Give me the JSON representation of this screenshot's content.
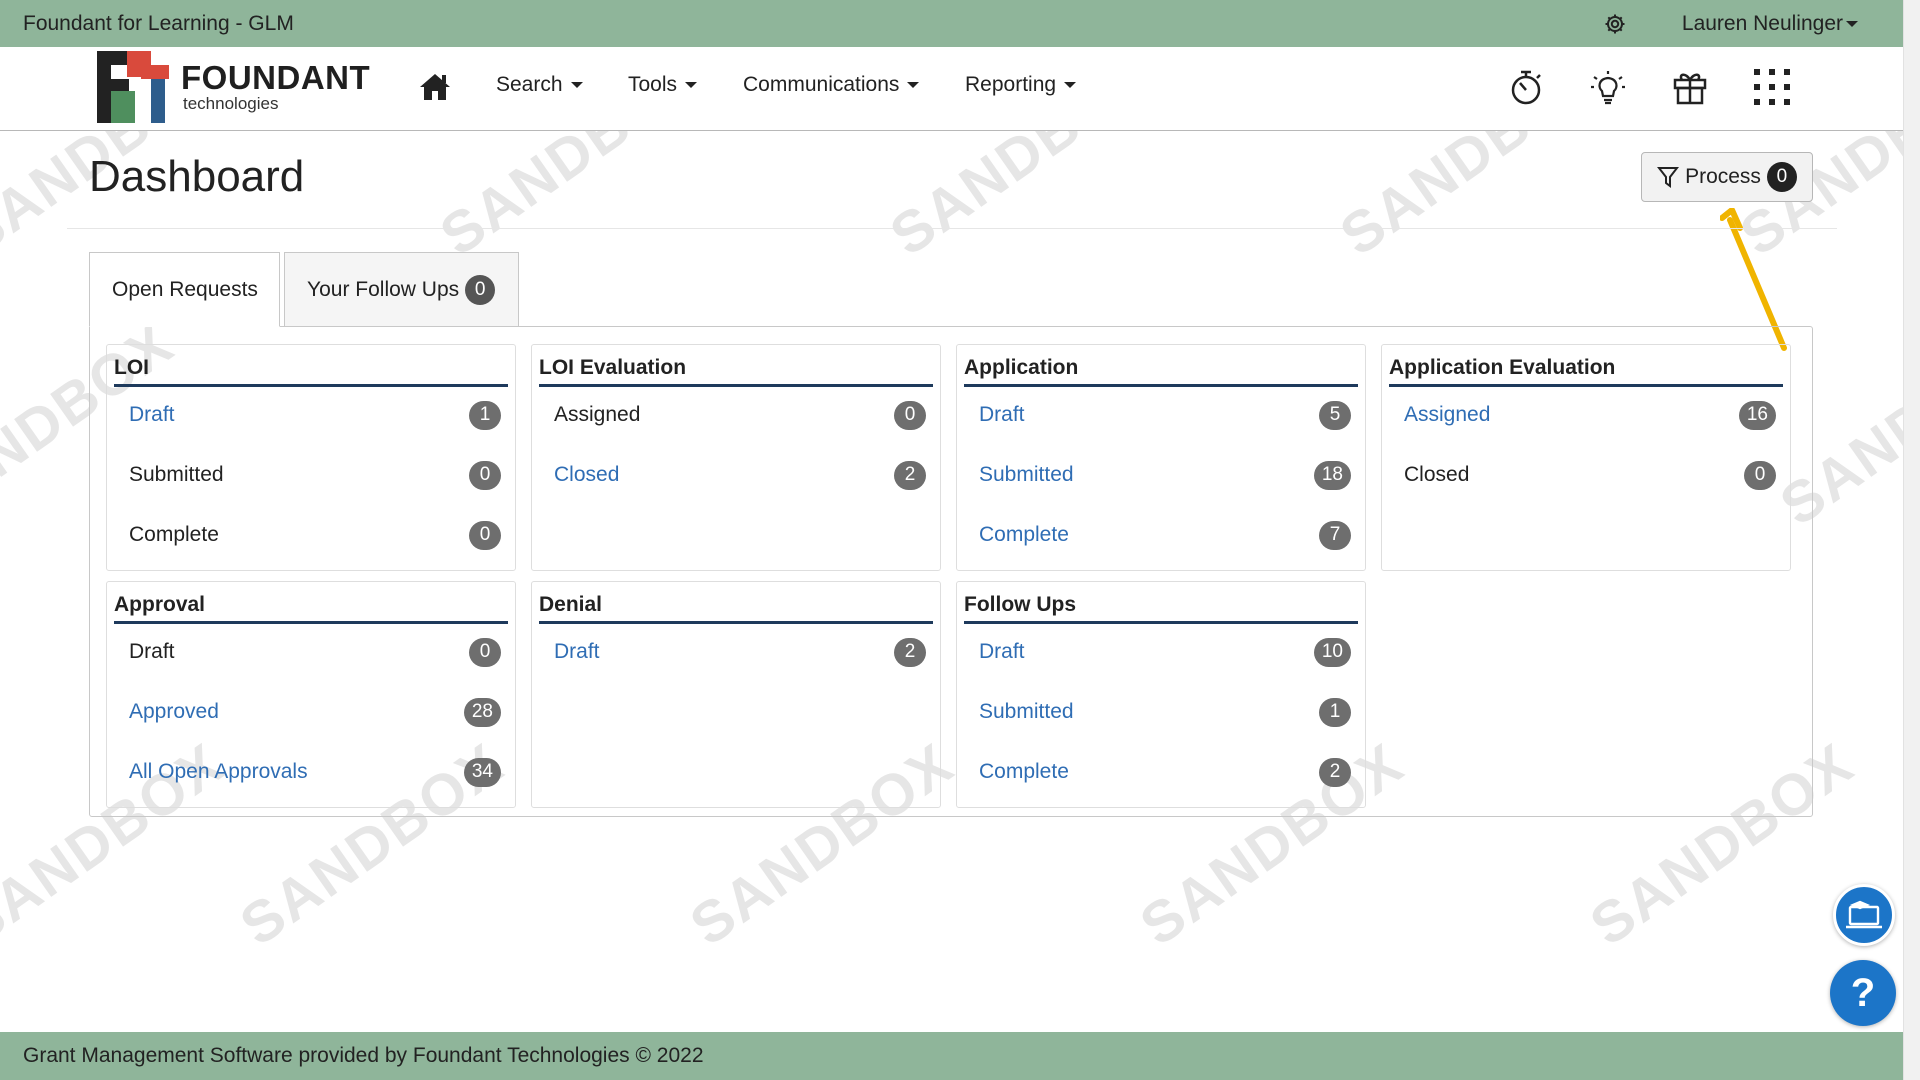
{
  "topbar": {
    "title": "Foundant for Learning - GLM",
    "user": "Lauren Neulinger",
    "gear_icon": "gear-icon"
  },
  "logo": {
    "brand": "FOUNDANT",
    "sub": "technologies"
  },
  "nav": {
    "home_icon": "home-icon",
    "items": [
      {
        "label": "Search"
      },
      {
        "label": "Tools"
      },
      {
        "label": "Communications"
      },
      {
        "label": "Reporting"
      }
    ],
    "right_icons": [
      "stopwatch-icon",
      "lightbulb-icon",
      "gift-icon",
      "apps-grid-icon"
    ]
  },
  "watermark": "SANDBOX",
  "page": {
    "title": "Dashboard",
    "process_label": "Process",
    "process_count": "0"
  },
  "tabs": [
    {
      "label": "Open Requests",
      "active": true
    },
    {
      "label": "Your Follow Ups",
      "count": "0",
      "active": false
    }
  ],
  "cards": [
    {
      "title": "LOI",
      "rows": [
        {
          "label": "Draft",
          "count": "1",
          "link": true
        },
        {
          "label": "Submitted",
          "count": "0",
          "link": false
        },
        {
          "label": "Complete",
          "count": "0",
          "link": false
        }
      ]
    },
    {
      "title": "LOI Evaluation",
      "rows": [
        {
          "label": "Assigned",
          "count": "0",
          "link": false
        },
        {
          "label": "Closed",
          "count": "2",
          "link": true
        }
      ]
    },
    {
      "title": "Application",
      "rows": [
        {
          "label": "Draft",
          "count": "5",
          "link": true
        },
        {
          "label": "Submitted",
          "count": "18",
          "link": true
        },
        {
          "label": "Complete",
          "count": "7",
          "link": true
        }
      ]
    },
    {
      "title": "Application Evaluation",
      "rows": [
        {
          "label": "Assigned",
          "count": "16",
          "link": true
        },
        {
          "label": "Closed",
          "count": "0",
          "link": false
        }
      ]
    },
    {
      "title": "Approval",
      "rows": [
        {
          "label": "Draft",
          "count": "0",
          "link": false
        },
        {
          "label": "Approved",
          "count": "28",
          "link": true
        },
        {
          "label": "All Open Approvals",
          "count": "34",
          "link": true
        }
      ]
    },
    {
      "title": "Denial",
      "rows": [
        {
          "label": "Draft",
          "count": "2",
          "link": true
        }
      ]
    },
    {
      "title": "Follow Ups",
      "rows": [
        {
          "label": "Draft",
          "count": "10",
          "link": true
        },
        {
          "label": "Submitted",
          "count": "1",
          "link": true
        },
        {
          "label": "Complete",
          "count": "2",
          "link": true
        }
      ]
    }
  ],
  "footer": {
    "text": "Grant Management Software provided by Foundant Technologies © 2022"
  },
  "fabs": {
    "learn_icon": "learning-laptop-icon",
    "help_label": "?"
  },
  "colors": {
    "top_bar": "#8fb59a",
    "link": "#2f6db4",
    "card_rule": "#1e3a5c",
    "badge": "#6e6e6e",
    "fab": "#1c75c8",
    "annotation_arrow": "#f0b400"
  }
}
